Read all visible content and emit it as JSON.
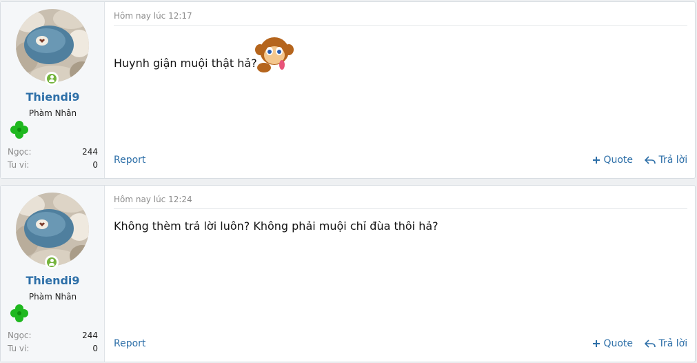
{
  "posts": [
    {
      "username": "Thiendi9",
      "user_title": "Phàm Nhân",
      "stats": [
        {
          "label": "Ngọc:",
          "value": "244"
        },
        {
          "label": "Tu vi:",
          "value": "0"
        }
      ],
      "time": "Hôm nay lúc 12:17",
      "message": "Huynh giận muội thật hả?",
      "report_label": "Report",
      "quote_label": "Quote",
      "reply_label": "Trả lời"
    },
    {
      "username": "Thiendi9",
      "user_title": "Phàm Nhân",
      "stats": [
        {
          "label": "Ngọc:",
          "value": "244"
        },
        {
          "label": "Tu vi:",
          "value": "0"
        }
      ],
      "time": "Hôm nay lúc 12:24",
      "message": "Không thèm trả lời luôn? Không phải muội chỉ đùa thôi hả?",
      "report_label": "Report",
      "quote_label": "Quote",
      "reply_label": "Trả lời"
    }
  ],
  "colors": {
    "link": "#2d6fa8",
    "online": "#74b43c",
    "clover": "#1fb81f"
  },
  "icons": [
    "online-status-icon",
    "clover-icon",
    "monkey-emoji-icon",
    "plus-icon",
    "reply-arrow-icon"
  ]
}
